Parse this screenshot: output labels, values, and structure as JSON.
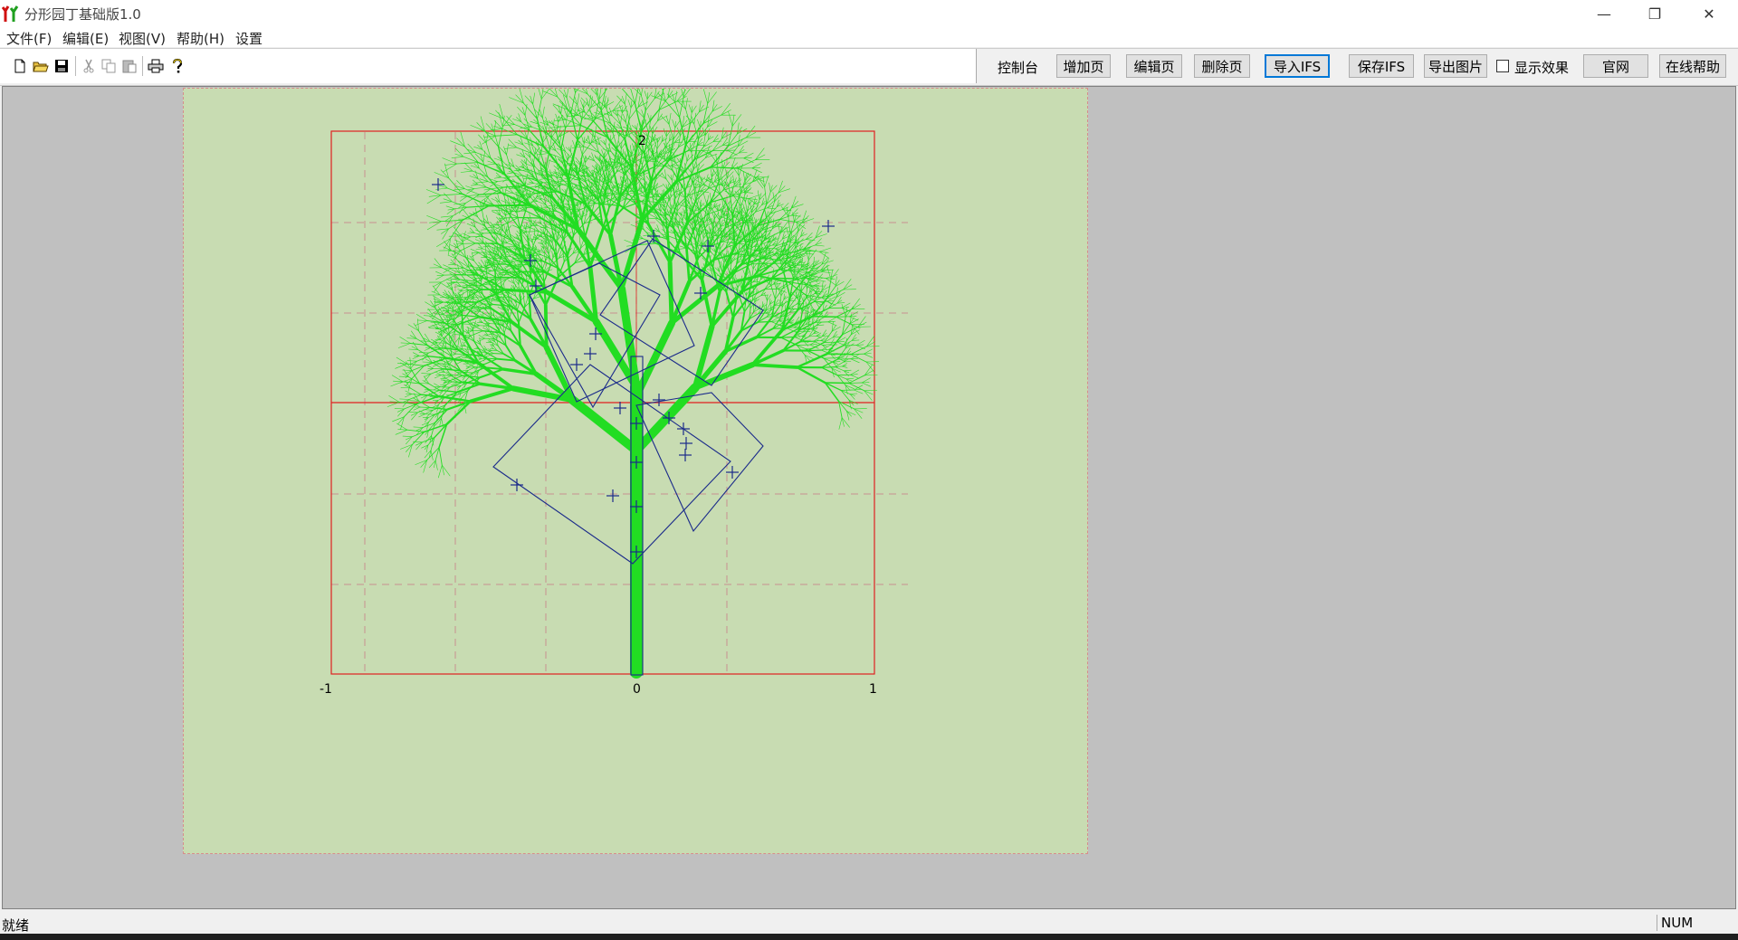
{
  "window": {
    "title": "分形园丁基础版1.0",
    "controls": [
      "—",
      "❐",
      "✕"
    ]
  },
  "menu": [
    "文件(F)",
    "编辑(E)",
    "视图(V)",
    "帮助(H)",
    "设置"
  ],
  "toolbar": {
    "icons": [
      "new-file-icon",
      "open-folder-icon",
      "save-icon",
      "cut-icon",
      "copy-icon",
      "paste-icon",
      "print-icon",
      "help-icon"
    ],
    "console_label": "控制台",
    "buttons": [
      "增加页",
      "编辑页",
      "删除页",
      "导入IFS",
      "保存IFS",
      "导出图片"
    ],
    "show_effect_label": "显示效果",
    "show_effect_checked": false,
    "website_button": "官网",
    "online_help_button": "在线帮助"
  },
  "plot": {
    "tick_labels": [
      "-1",
      "0",
      "1",
      "2"
    ],
    "colors": {
      "canvas_bg": "#c8dcb2",
      "frame": "#e02020",
      "grid": "#c89090",
      "tree": "#22dd22",
      "transform_boxes": "#1a2a8a",
      "workspace": "#c0c0c0"
    }
  },
  "status": {
    "text": "就绪",
    "num": "NUM"
  }
}
